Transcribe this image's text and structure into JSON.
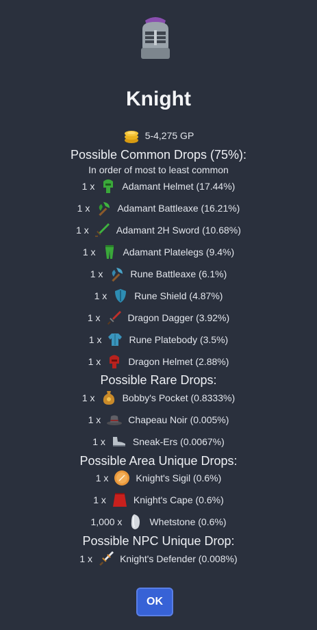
{
  "npc": {
    "name": "Knight",
    "icon": "knight-helmet-icon"
  },
  "coins": {
    "text": "5-4,275 GP",
    "icon": "coins-icon"
  },
  "common": {
    "heading": "Possible Common Drops (75%):",
    "subheading": "In order of most to least common",
    "items": [
      {
        "qty": "1 x",
        "label": "Adamant Helmet (17.44%)",
        "icon": "adamant-helmet-icon"
      },
      {
        "qty": "1 x",
        "label": "Adamant Battleaxe (16.21%)",
        "icon": "adamant-battleaxe-icon"
      },
      {
        "qty": "1 x",
        "label": "Adamant 2H Sword (10.68%)",
        "icon": "adamant-2h-sword-icon"
      },
      {
        "qty": "1 x",
        "label": "Adamant Platelegs (9.4%)",
        "icon": "adamant-platelegs-icon"
      },
      {
        "qty": "1 x",
        "label": "Rune Battleaxe (6.1%)",
        "icon": "rune-battleaxe-icon"
      },
      {
        "qty": "1 x",
        "label": "Rune Shield (4.87%)",
        "icon": "rune-shield-icon"
      },
      {
        "qty": "1 x",
        "label": "Dragon Dagger (3.92%)",
        "icon": "dragon-dagger-icon"
      },
      {
        "qty": "1 x",
        "label": "Rune Platebody (3.5%)",
        "icon": "rune-platebody-icon"
      },
      {
        "qty": "1 x",
        "label": "Dragon Helmet (2.88%)",
        "icon": "dragon-helmet-icon"
      }
    ]
  },
  "rare": {
    "heading": "Possible Rare Drops:",
    "items": [
      {
        "qty": "1 x",
        "label": "Bobby's Pocket (0.8333%)",
        "icon": "bobbys-pocket-icon"
      },
      {
        "qty": "1 x",
        "label": "Chapeau Noir (0.005%)",
        "icon": "chapeau-noir-icon"
      },
      {
        "qty": "1 x",
        "label": "Sneak-Ers (0.0067%)",
        "icon": "sneak-ers-icon"
      }
    ]
  },
  "area": {
    "heading": "Possible Area Unique Drops:",
    "items": [
      {
        "qty": "1 x",
        "label": "Knight's Sigil (0.6%)",
        "icon": "knights-sigil-icon"
      },
      {
        "qty": "1 x",
        "label": "Knight's Cape (0.6%)",
        "icon": "knights-cape-icon"
      },
      {
        "qty": "1,000 x",
        "label": "Whetstone (0.6%)",
        "icon": "whetstone-icon"
      }
    ]
  },
  "npc_unique": {
    "heading": "Possible NPC Unique Drop:",
    "items": [
      {
        "qty": "1 x",
        "label": "Knight's Defender (0.008%)",
        "icon": "knights-defender-icon"
      }
    ]
  },
  "ok_label": "OK",
  "colors": {
    "background": "#2a303d",
    "button": "#3762d6"
  }
}
